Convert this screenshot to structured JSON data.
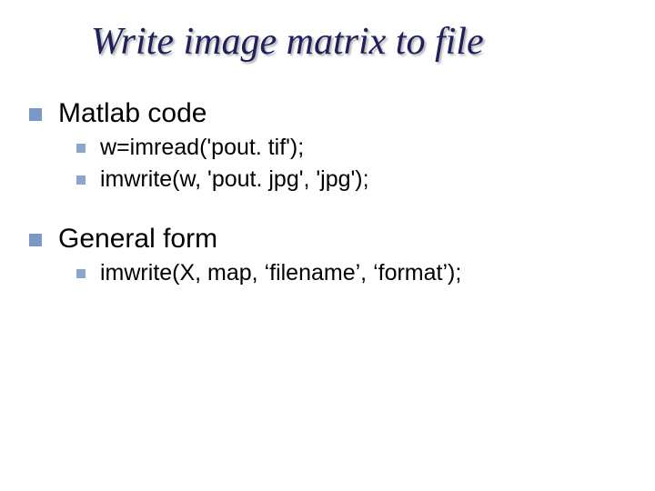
{
  "title": "Write image matrix to file",
  "section1": {
    "heading": "Matlab code",
    "items": [
      "w=imread('pout. tif');",
      "imwrite(w, 'pout. jpg', 'jpg');"
    ]
  },
  "section2": {
    "heading": "General form",
    "items": [
      "imwrite(X, map, ‘filename’, ‘format’);"
    ]
  }
}
